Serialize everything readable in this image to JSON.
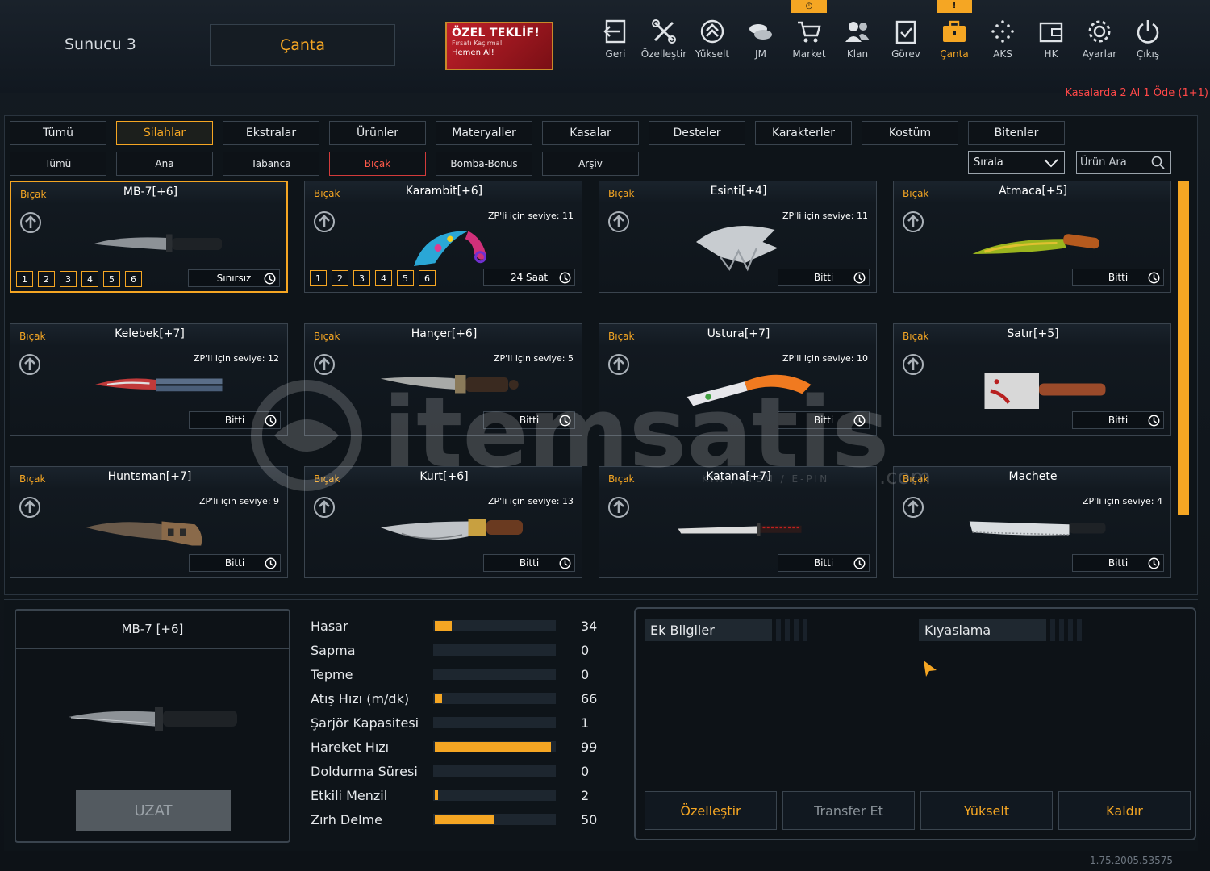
{
  "header": {
    "server": "Sunucu 3",
    "title": "Çanta",
    "offer": {
      "line1": "ÖZEL TEKLİF!",
      "line2": "Fırsatı Kaçırma!",
      "line3": "Hemen Al!"
    },
    "nav": [
      {
        "label": "Geri",
        "icon": "exit-icon"
      },
      {
        "label": "Özelleştir",
        "icon": "tools-icon"
      },
      {
        "label": "Yükselt",
        "icon": "rank-up-icon"
      },
      {
        "label": "JM",
        "icon": "coins-icon"
      },
      {
        "label": "Market",
        "icon": "cart-icon",
        "badge": "◷"
      },
      {
        "label": "Klan",
        "icon": "clan-icon"
      },
      {
        "label": "Görev",
        "icon": "mission-icon"
      },
      {
        "label": "Çanta",
        "icon": "bag-icon",
        "badge": "!"
      },
      {
        "label": "AKS",
        "icon": "dots-icon"
      },
      {
        "label": "HK",
        "icon": "wallet-icon"
      },
      {
        "label": "Ayarlar",
        "icon": "gear-icon"
      },
      {
        "label": "Çıkış",
        "icon": "power-icon"
      }
    ],
    "promo": "Kasalarda 2 Al 1 Öde (1+1)"
  },
  "tabs": [
    "Tümü",
    "Silahlar",
    "Ekstralar",
    "Ürünler",
    "Materyaller",
    "Kasalar",
    "Desteler",
    "Karakterler",
    "Kostüm",
    "Bitenler"
  ],
  "selected_tab": "Silahlar",
  "subtabs": [
    "Tümü",
    "Ana",
    "Tabanca",
    "Bıçak",
    "Bomba-Bonus",
    "Arşiv"
  ],
  "selected_subtab": "Bıçak",
  "sort": {
    "label": "Sırala"
  },
  "search": {
    "placeholder": "Ürün Ara"
  },
  "items": [
    {
      "cat": "Bıçak",
      "name": "MB-7[+6]",
      "level": "",
      "status": "Sınırsız",
      "slots": [
        "1",
        "2",
        "3",
        "4",
        "5",
        "6"
      ],
      "selected": true
    },
    {
      "cat": "Bıçak",
      "name": "Karambit[+6]",
      "level": "ZP'li için seviye: 11",
      "status": "24 Saat",
      "slots": [
        "1",
        "2",
        "3",
        "4",
        "5",
        "6"
      ]
    },
    {
      "cat": "Bıçak",
      "name": "Esinti[+4]",
      "level": "ZP'li için seviye: 11",
      "status": "Bitti"
    },
    {
      "cat": "Bıçak",
      "name": "Atmaca[+5]",
      "level": "",
      "status": "Bitti"
    },
    {
      "cat": "Bıçak",
      "name": "Kelebek[+7]",
      "level": "ZP'li için seviye: 12",
      "status": "Bitti"
    },
    {
      "cat": "Bıçak",
      "name": "Hançer[+6]",
      "level": "ZP'li için seviye: 5",
      "status": "Bitti"
    },
    {
      "cat": "Bıçak",
      "name": "Ustura[+7]",
      "level": "ZP'li için seviye: 10",
      "status": "Bitti"
    },
    {
      "cat": "Bıçak",
      "name": "Satır[+5]",
      "level": "",
      "status": "Bitti"
    },
    {
      "cat": "Bıçak",
      "name": "Huntsman[+7]",
      "level": "ZP'li için seviye: 9",
      "status": "Bitti"
    },
    {
      "cat": "Bıçak",
      "name": "Kurt[+6]",
      "level": "ZP'li için seviye: 13",
      "status": "Bitti"
    },
    {
      "cat": "Bıçak",
      "name": "Katana[+7]",
      "level": "",
      "status": "Bitti"
    },
    {
      "cat": "Bıçak",
      "name": "Machete",
      "level": "ZP'li için seviye: 4",
      "status": "Bitti"
    }
  ],
  "preview": {
    "name": "MB-7 [+6]",
    "button": "UZAT"
  },
  "stats": [
    {
      "label": "Hasar",
      "value": "34",
      "fill": 0.14
    },
    {
      "label": "Sapma",
      "value": "0",
      "fill": 0
    },
    {
      "label": "Tepme",
      "value": "0",
      "fill": 0
    },
    {
      "label": "Atış Hızı (m/dk)",
      "value": "66",
      "fill": 0.06
    },
    {
      "label": "Şarjör Kapasitesi",
      "value": "1",
      "fill": 0
    },
    {
      "label": "Hareket Hızı",
      "value": "99",
      "fill": 0.97
    },
    {
      "label": "Doldurma Süresi",
      "value": "0",
      "fill": 0
    },
    {
      "label": "Etkili Menzil",
      "value": "2",
      "fill": 0.02
    },
    {
      "label": "Zırh Delme",
      "value": "50",
      "fill": 0.49
    }
  ],
  "info": {
    "extra": "Ek Bilgiler",
    "compare": "Kıyaslama",
    "buttons": [
      "Özelleştir",
      "Transfer Et",
      "Yükselt",
      "Kaldır"
    ]
  },
  "watermark": {
    "brand": "itemsatis",
    "domain": ".com",
    "tag": "KIN / ITEM / E-PIN"
  },
  "version": "1.75.2005.53575",
  "colors": {
    "accent": "#f5a623",
    "danger": "#ff4848"
  }
}
